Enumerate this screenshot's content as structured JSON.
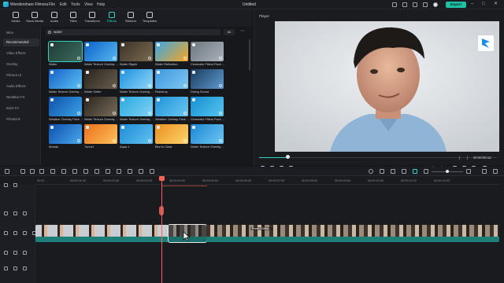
{
  "app": {
    "name": "Wondershare Filmora",
    "document": "Untitled"
  },
  "menu": [
    "File",
    "Edit",
    "Tools",
    "View",
    "Help"
  ],
  "export_label": "Export",
  "window_controls": [
    "–",
    "□",
    "✕"
  ],
  "toolbar": [
    {
      "label": "Media",
      "icon": "media-icon"
    },
    {
      "label": "Stock Media",
      "icon": "stock-media-icon"
    },
    {
      "label": "Audio",
      "icon": "audio-icon"
    },
    {
      "label": "Titles",
      "icon": "titles-icon"
    },
    {
      "label": "Transitions",
      "icon": "transitions-icon"
    },
    {
      "label": "Effects",
      "icon": "effects-icon",
      "active": true
    },
    {
      "label": "Stickers",
      "icon": "stickers-icon"
    },
    {
      "label": "Templates",
      "icon": "templates-icon"
    }
  ],
  "sidebar": {
    "items": [
      "Mine",
      "Recommended",
      "Video Effects",
      "Overlay",
      "Filmora UI",
      "Audio Effects",
      "NewBlue FX",
      "Boris FX",
      "Filmstock"
    ],
    "selected": "Recommended"
  },
  "search": {
    "query": "water",
    "filter": "All"
  },
  "effects": [
    {
      "name": "Water",
      "colors": [
        "#1d3b34",
        "#3e6b5f"
      ]
    },
    {
      "name": "Water Texture Overlay ...",
      "colors": [
        "#0a62c9",
        "#58b7f0"
      ]
    },
    {
      "name": "Water Ripple",
      "colors": [
        "#3b3326",
        "#7a6a52"
      ]
    },
    {
      "name": "Water Reflection",
      "colors": [
        "#3aa6e6",
        "#f5a623"
      ]
    },
    {
      "name": "Cinematic Filters Pack ...",
      "colors": [
        "#6e7680",
        "#a9b1ba"
      ]
    },
    {
      "name": "Water Texture Overlay ...",
      "colors": [
        "#1460c8",
        "#5cc2f2"
      ]
    },
    {
      "name": "Water Suffer",
      "colors": [
        "#27231e",
        "#6a5e4e"
      ]
    },
    {
      "name": "Water Texture Overlay ...",
      "colors": [
        "#1d90df",
        "#8fd7f7"
      ]
    },
    {
      "name": "Raindrop",
      "colors": [
        "#3e97e0",
        "#7ec7f2"
      ]
    },
    {
      "name": "Diving Sound",
      "colors": [
        "#1b3c5e",
        "#5e9ad0"
      ]
    },
    {
      "name": "Weather Overlay Pack ...",
      "colors": [
        "#0e4fa6",
        "#3ba3e8"
      ]
    },
    {
      "name": "Water Texture Overlay ...",
      "colors": [
        "#2a2520",
        "#7a6c58"
      ]
    },
    {
      "name": "Water Texture Overlay ...",
      "colors": [
        "#2aa7e0",
        "#7fd3f4"
      ]
    },
    {
      "name": "Weather Overlay Pack ...",
      "colors": [
        "#1e92d8",
        "#6cc7f1"
      ]
    },
    {
      "name": "Cinematic Filters Pack ...",
      "colors": [
        "#128fd1",
        "#59c4ef"
      ]
    },
    {
      "name": "Mosaic",
      "colors": [
        "#0d4fb0",
        "#4aa8ea"
      ]
    },
    {
      "name": "Tunnel",
      "colors": [
        "#e8701c",
        "#ffc15a"
      ]
    },
    {
      "name": "Aqua 1",
      "colors": [
        "#1d8bd6",
        "#62c1f0"
      ]
    },
    {
      "name": "Blur to Clear",
      "colors": [
        "#e9901f",
        "#ffd46b"
      ]
    },
    {
      "name": "Water Texture Overlay ...",
      "colors": [
        "#1b86d4",
        "#6fc7f2"
      ]
    }
  ],
  "player": {
    "label": "Player",
    "timecode": "00:00:00:12",
    "brackets": [
      "{",
      "}"
    ],
    "quality": "Full Quality",
    "progress": 0.12
  },
  "timeline": {
    "ruler": [
      "00:00",
      "00:00:01:00",
      "00:00:02:00",
      "00:00:03:00",
      "00:00:04:00",
      "00:00:05:00",
      "00:00:06:00",
      "00:00:07:00",
      "00:00:08:00",
      "00:00:09:00",
      "00:00:10:00",
      "00:00:11:00",
      "00:00:12:00"
    ],
    "clips": [
      {
        "name": ""
      },
      {
        "name": ""
      },
      {
        "name": "Pixel - Glitch..."
      }
    ]
  }
}
